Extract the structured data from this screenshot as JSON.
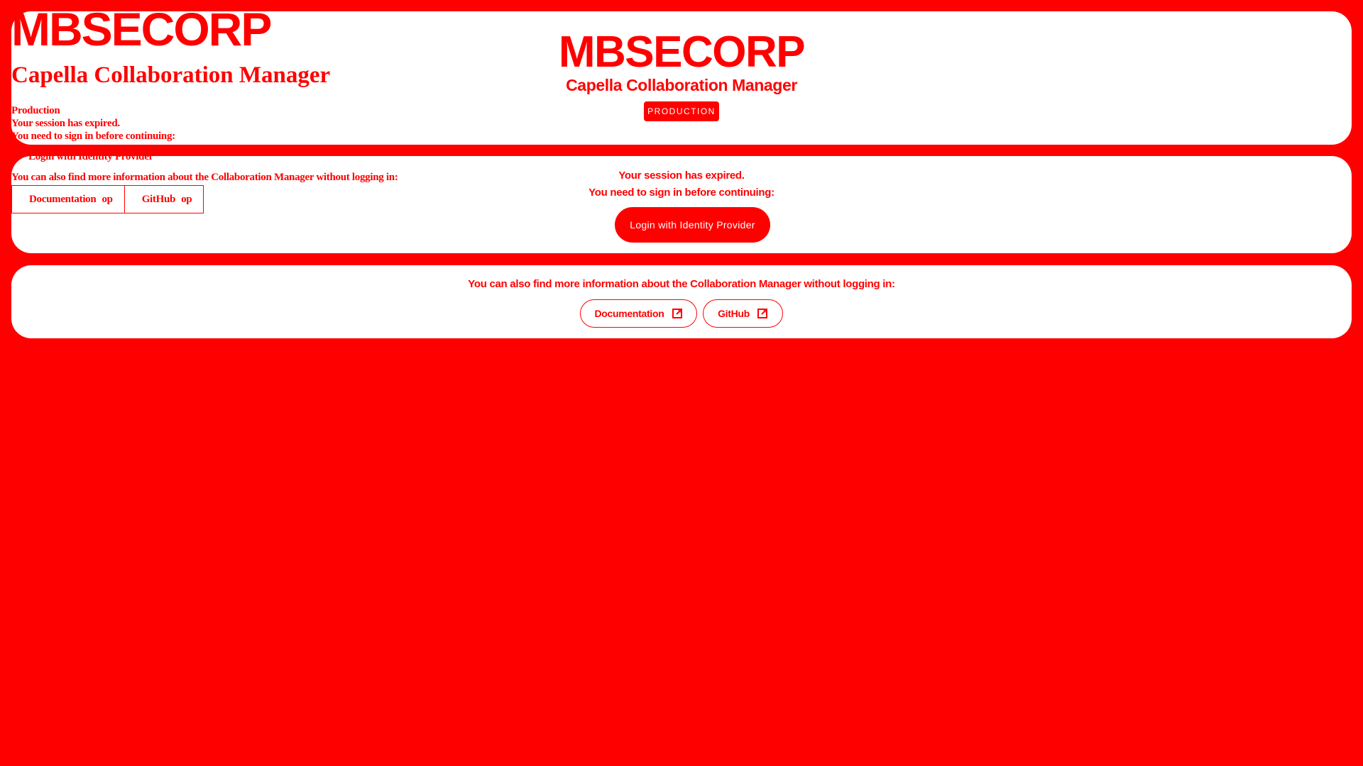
{
  "brand": {
    "logo": "MBSECORP",
    "subtitle": "Capella Collaboration Manager",
    "environment_badge": "PRODUCTION"
  },
  "overlay": {
    "logo": "MBSECORP",
    "title": "Capella Collaboration Manager",
    "environment": "Production",
    "session_expired": "Your session has expired.",
    "sign_in_prompt": "You need to sign in before continuing:",
    "login_label": "Login with Identity Provider",
    "info_text": "You can also find more information about the Collaboration Manager without logging in:",
    "documentation_label": "Documentation",
    "github_label": "GitHub",
    "link_icon_text": "op"
  },
  "login": {
    "session_expired": "Your session has expired.",
    "sign_in_prompt": "You need to sign in before continuing:",
    "button_label": "Login with Identity Provider"
  },
  "info": {
    "text": "You can also find more information about the Collaboration Manager without logging in:",
    "documentation_label": "Documentation",
    "github_label": "GitHub",
    "link_icon": "open-in-new-icon"
  },
  "colors": {
    "background": "#ff0000",
    "card": "#ffffff",
    "accent": "#ff0000"
  }
}
